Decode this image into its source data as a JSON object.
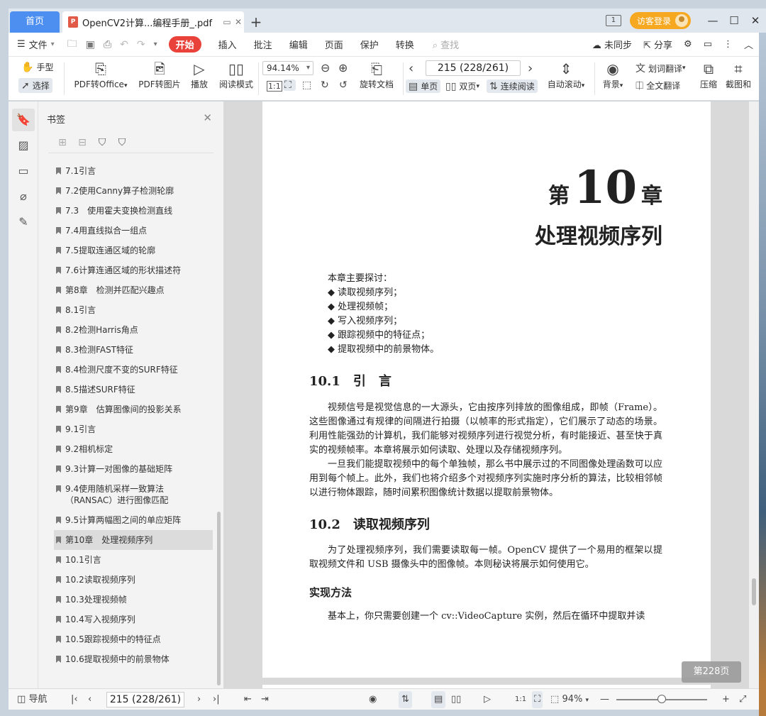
{
  "titlebar": {
    "home_tab": "首页",
    "doc_tab": "OpenCV2计算...编程手册_.pdf",
    "pdf_badge": "P",
    "guest_login": "访客登录"
  },
  "menu": {
    "file": "文件",
    "start": "开始",
    "items": [
      "插入",
      "批注",
      "编辑",
      "页面",
      "保护",
      "转换"
    ],
    "search": "查找",
    "unsynced": "未同步",
    "share": "分享"
  },
  "toolbar": {
    "hand": "手型",
    "select": "选择",
    "pdf_to_office": "PDF转Office",
    "pdf_to_image": "PDF转图片",
    "play": "播放",
    "read_mode": "阅读模式",
    "zoom": "94.14%",
    "rotate_doc": "旋转文档",
    "page_indicator": "215 (228/261)",
    "single_page": "单页",
    "double_page": "双页",
    "continuous": "连续阅读",
    "auto_scroll": "自动滚动",
    "background": "背景",
    "word_translate": "划词翻译",
    "full_translate": "全文翻译",
    "compress": "压缩",
    "screenshot": "截图和"
  },
  "bookmarks": {
    "title": "书签",
    "items": [
      "7.1引言",
      "7.2使用Canny算子检测轮廓",
      "7.3　使用霍夫变换检测直线",
      "7.4用直线拟合一组点",
      "7.5提取连通区域的轮廓",
      "7.6计算连通区域的形状描述符",
      "第8章　检测并匹配兴趣点",
      "8.1引言",
      "8.2检测Harris角点",
      "8.3检测FAST特征",
      "8.4检测尺度不变的SURF特征",
      "8.5描述SURF特征",
      "第9章　估算图像间的投影关系",
      "9.1引言",
      "9.2相机标定",
      "9.3计算一对图像的基础矩阵",
      "9.4使用随机采样一致算法（RANSAC）进行图像匹配",
      "9.5计算两幅图之间的单应矩阵",
      "第10章　处理视频序列",
      "10.1引言",
      "10.2读取视频序列",
      "10.3处理视频帧",
      "10.4写入视频序列",
      "10.5跟踪视频中的特征点",
      "10.6提取视频中的前景物体"
    ],
    "selected_index": 18
  },
  "document": {
    "chapter_prefix": "第",
    "chapter_number": "10",
    "chapter_suffix": "章",
    "chapter_title": "处理视频序列",
    "topics_intro": "本章主要探讨：",
    "topics": [
      "◆ 读取视频序列；",
      "◆ 处理视频帧；",
      "◆ 写入视频序列；",
      "◆ 跟踪视频中的特征点；",
      "◆ 提取视频中的前景物体。"
    ],
    "sec1_title": "10.1　引　言",
    "sec1_p1": "视频信号是视觉信息的一大源头，它由按序列排放的图像组成，即帧（Frame）。这些图像通过有规律的间隔进行拍摄（以帧率的形式指定），它们展示了动态的场景。利用性能强劲的计算机，我们能够对视频序列进行视觉分析，有时能接近、甚至快于真实的视频帧率。本章将展示如何读取、处理以及存储视频序列。",
    "sec1_p2": "一旦我们能提取视频中的每个单独帧，那么书中展示过的不同图像处理函数可以应用到每个帧上。此外，我们也将介绍多个对视频序列实施时序分析的算法，比较相邻帧以进行物体跟踪，随时间累积图像统计数据以提取前景物体。",
    "sec2_title": "10.2　读取视频序列",
    "sec2_p1": "为了处理视频序列，我们需要读取每一帧。OpenCV 提供了一个易用的框架以提取视频文件和 USB 摄像头中的图像帧。本则秘诀将展示如何使用它。",
    "sub_title": "实现方法",
    "sub_p1": "基本上，你只需要创建一个 cv::VideoCapture 实例，然后在循环中提取并读",
    "page_pill": "第228页"
  },
  "statusbar": {
    "nav": "导航",
    "page": "215 (228/261)",
    "zoom": "94%"
  }
}
